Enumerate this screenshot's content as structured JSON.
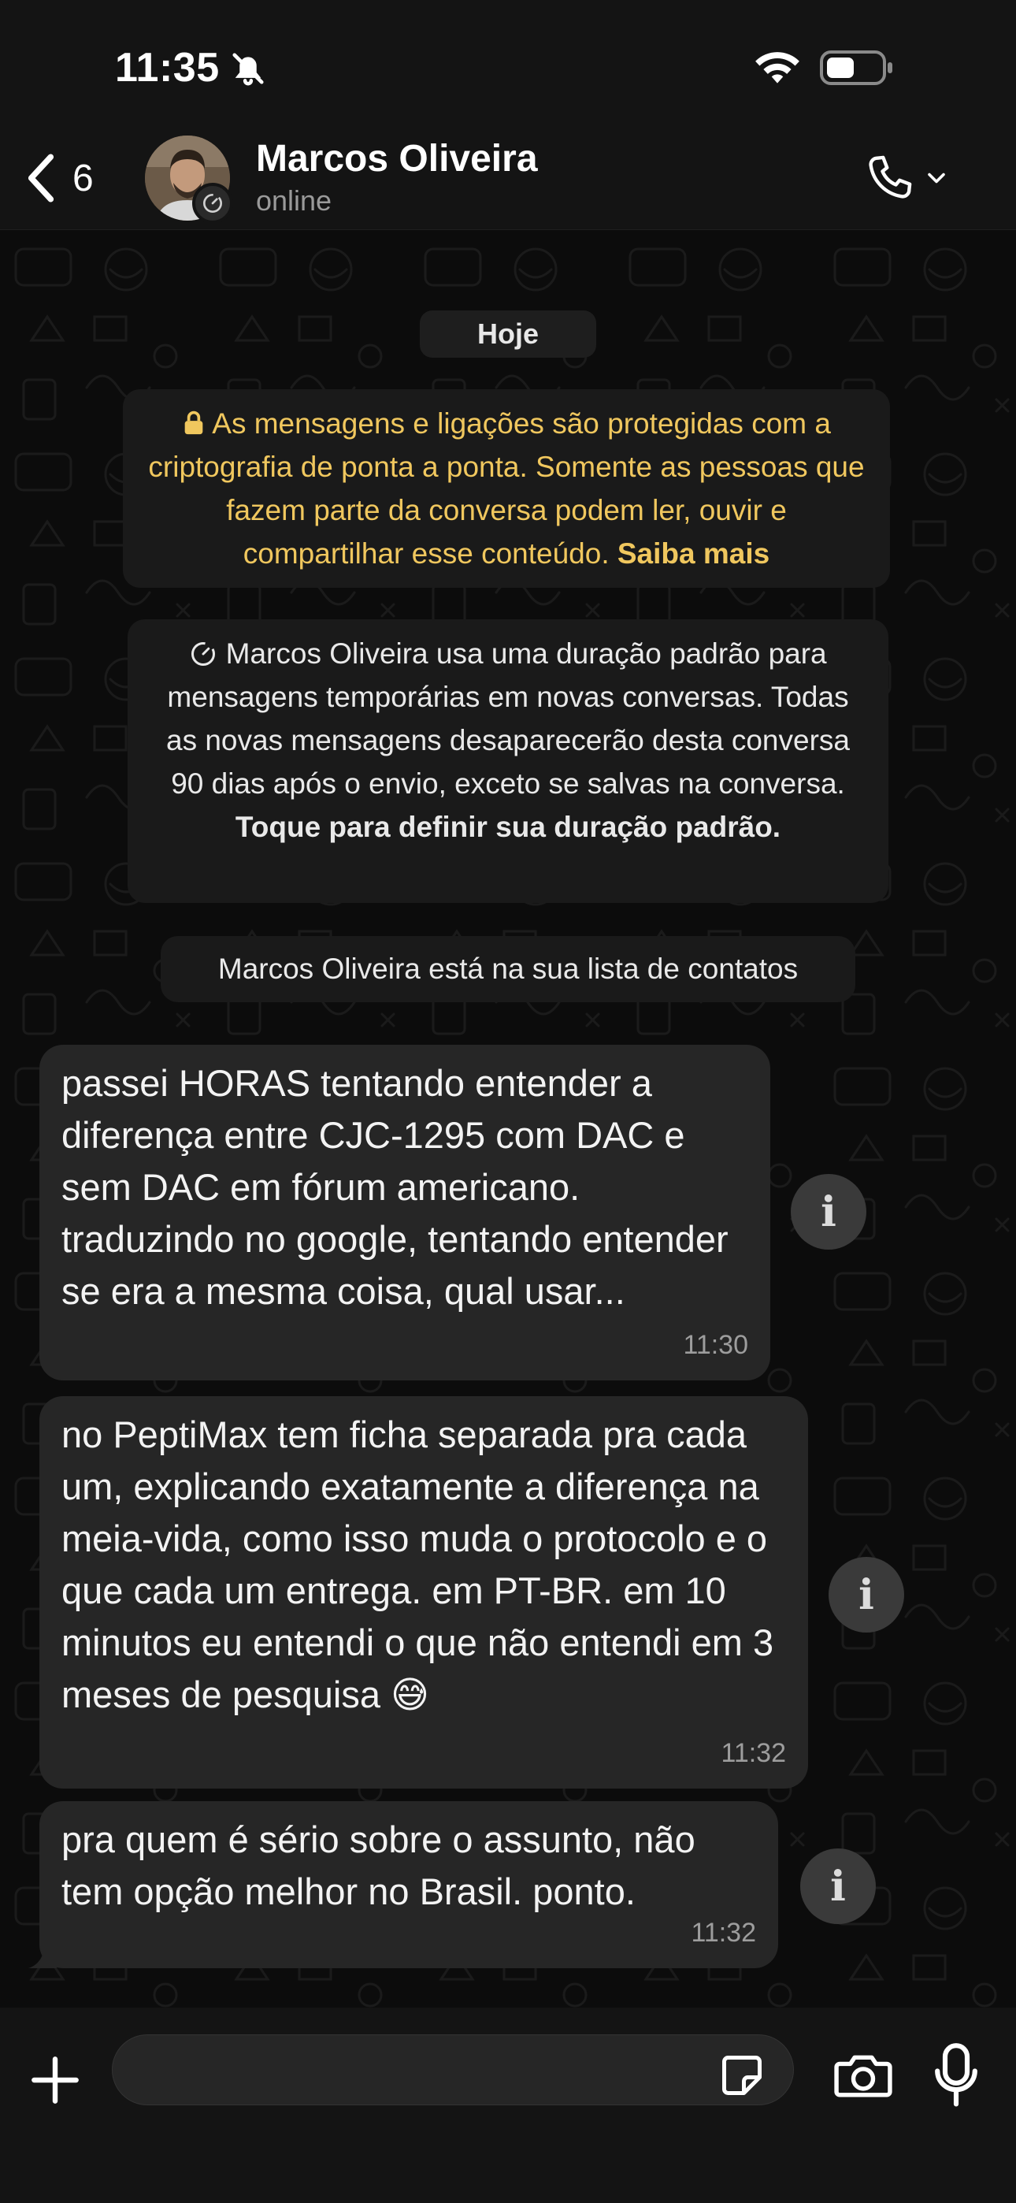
{
  "status_bar": {
    "time": "11:35"
  },
  "header": {
    "back_count": "6",
    "contact_name": "Marcos Oliveira",
    "contact_status": "online"
  },
  "chat": {
    "date_label": "Hoje",
    "encryption_notice": "As mensagens e ligações são protegidas com a criptografia de ponta a ponta. Somente as pessoas que fazem parte da conversa podem ler, ouvir e compartilhar esse conteúdo.",
    "encryption_link": "Saiba mais",
    "disappearing_notice": "Marcos Oliveira usa uma duração padrão para mensagens temporárias em novas conversas. Todas as novas mensagens desaparecerão desta conversa 90 dias após o envio, exceto se salvas na conversa.",
    "disappearing_action": "Toque para definir sua duração padrão.",
    "contact_notice": "Marcos Oliveira está na sua lista de contatos",
    "messages": [
      {
        "text": "passei HORAS tentando entender a diferença entre CJC-1295 com DAC e sem DAC em fórum americano. traduzindo no google, tentando entender se era a mesma coisa, qual usar...",
        "time": "11:30"
      },
      {
        "text": "no PeptiMax tem ficha separada pra cada um, explicando exatamente a diferença na meia-vida, como isso muda o protocolo e o que cada um entrega. em PT-BR. em 10 minutos eu entendi o que não entendi em 3 meses de pesquisa 😅",
        "time": "11:32"
      },
      {
        "text": "pra quem é sério sobre o assunto, não tem opção melhor no Brasil. ponto.",
        "time": "11:32"
      }
    ]
  },
  "icons": {
    "back": "chevron-left-icon",
    "call": "phone-icon",
    "info": "info-icon",
    "plus": "plus-icon",
    "sticker": "sticker-icon",
    "camera": "camera-icon",
    "mic": "microphone-icon"
  },
  "colors": {
    "encryption_text": "#f0c75e",
    "bubble": "#262626",
    "background": "#0b0b0b"
  }
}
